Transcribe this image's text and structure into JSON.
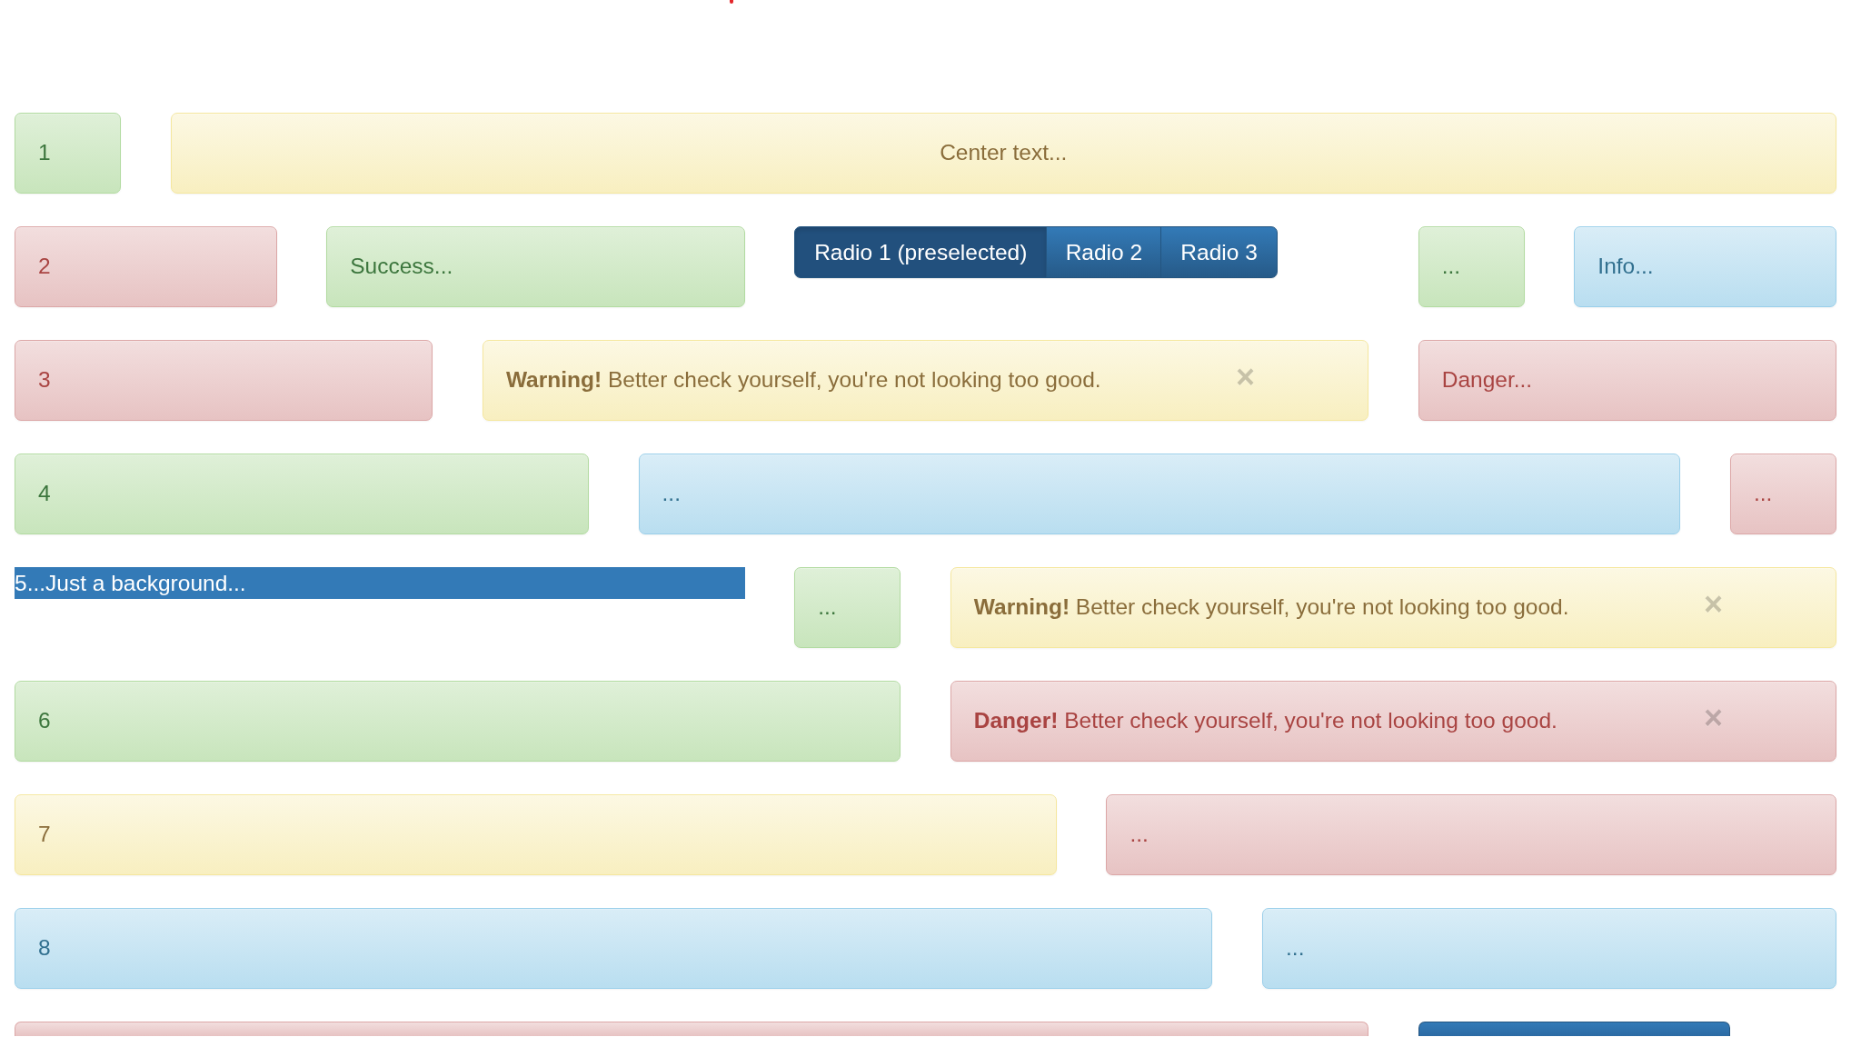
{
  "rows": [
    {
      "items": [
        {
          "kind": "success",
          "text": "1"
        },
        {
          "kind": "warning",
          "text": "Center text..."
        }
      ]
    },
    {
      "items": [
        {
          "kind": "danger",
          "text": "2"
        },
        {
          "kind": "success",
          "text": "Success..."
        },
        {
          "kind": "radio-group",
          "options": [
            {
              "label": "Radio 1 (preselected)",
              "selected": true
            },
            {
              "label": "Radio 2",
              "selected": false
            },
            {
              "label": "Radio 3",
              "selected": false
            }
          ]
        },
        {
          "kind": "success",
          "text": "..."
        },
        {
          "kind": "info",
          "text": "Info..."
        }
      ]
    },
    {
      "items": [
        {
          "kind": "danger",
          "text": "3"
        },
        {
          "kind": "warning",
          "text": "**Warning!** Better check yourself, you're not looking too good.",
          "close": "×"
        },
        {
          "kind": "danger",
          "text": "Danger..."
        }
      ]
    },
    {
      "items": [
        {
          "kind": "success",
          "text": "4"
        },
        {
          "kind": "info",
          "text": "..."
        },
        {
          "kind": "danger",
          "text": "..."
        }
      ]
    },
    {
      "items": [
        {
          "kind": "background",
          "text": "5...Just a background..."
        },
        {
          "kind": "success",
          "text": "..."
        },
        {
          "kind": "warning",
          "text": "**Warning!** Better check yourself, you're not looking too good.",
          "close": "×"
        }
      ]
    },
    {
      "items": [
        {
          "kind": "success",
          "text": "6"
        },
        {
          "kind": "danger",
          "text": "**Danger!** Better check yourself, you're not looking too good.",
          "close": "×"
        }
      ]
    },
    {
      "items": [
        {
          "kind": "warning",
          "text": "7"
        },
        {
          "kind": "danger",
          "text": "..."
        }
      ]
    },
    {
      "items": [
        {
          "kind": "info",
          "text": "8"
        },
        {
          "kind": "info",
          "text": "..."
        }
      ]
    },
    {
      "items": [
        {
          "kind": "danger"
        },
        {
          "kind": "button"
        }
      ]
    }
  ]
}
